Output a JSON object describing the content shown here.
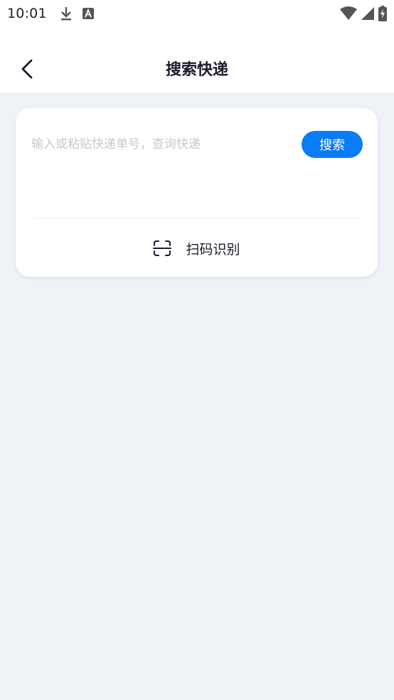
{
  "status_bar": {
    "time": "10:01",
    "left_icons": [
      "download-icon",
      "text-a-icon"
    ],
    "right_icons": [
      "wifi-icon",
      "signal-icon",
      "battery-icon"
    ]
  },
  "header": {
    "back_icon": "chevron-left-icon",
    "title": "搜索快递"
  },
  "search_card": {
    "input_value": "",
    "input_placeholder": "输入或粘贴快递单号，查询快递",
    "search_button_label": "搜索",
    "scan_icon": "scan-icon",
    "scan_label": "扫码识别"
  },
  "colors": {
    "accent": "#0a7cf7",
    "page_background": "#eff3f8",
    "card_background": "#ffffff",
    "title_text": "#1a1c2e",
    "placeholder_text": "#c6c9cf"
  }
}
